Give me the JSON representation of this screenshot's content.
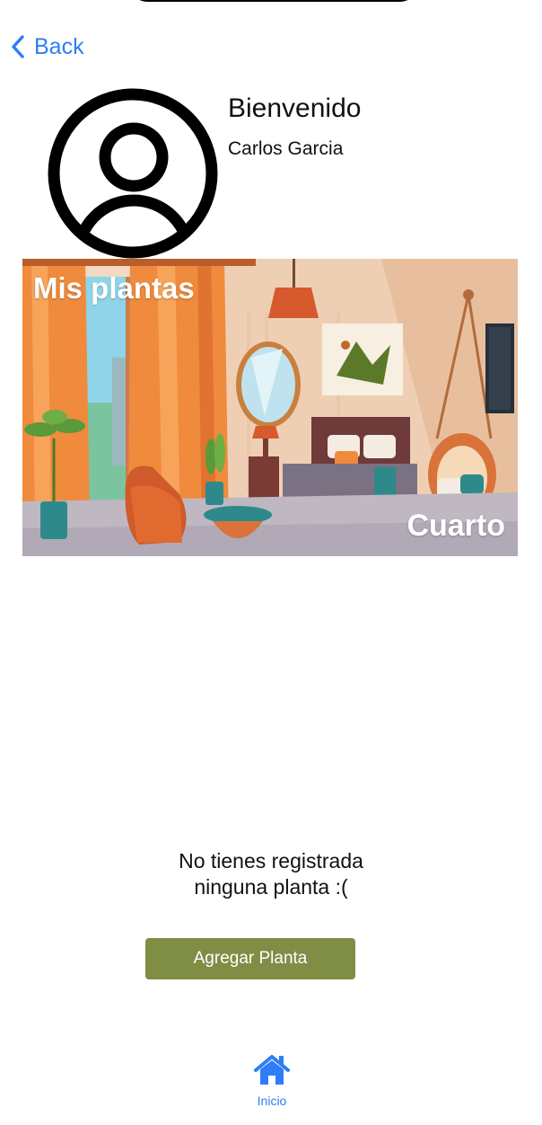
{
  "header": {
    "back_label": "Back",
    "back_icon": "chevron-left-icon"
  },
  "profile": {
    "avatar_icon": "user-avatar-icon",
    "welcome": "Bienvenido",
    "name": "Carlos Garcia"
  },
  "room_card": {
    "title": "Mis plantas",
    "room_name": "Cuarto",
    "image": "bedroom-illustration"
  },
  "empty_state": {
    "message": "No tienes registrada\nninguna planta :("
  },
  "actions": {
    "add_plant_label": "Agregar Planta"
  },
  "tab_bar": {
    "items": [
      {
        "label": "Inicio",
        "icon": "home-icon",
        "active": true
      }
    ]
  },
  "colors": {
    "accent_blue": "#2f7df6",
    "button_green": "#808d45",
    "text": "#111111"
  }
}
